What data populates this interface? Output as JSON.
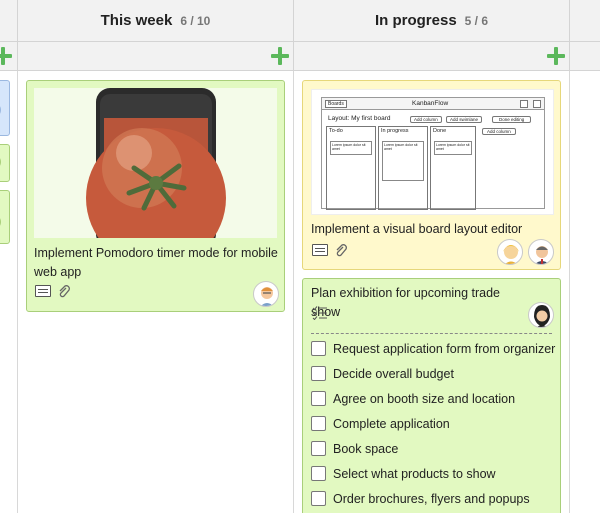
{
  "columns": [
    {
      "title": "This week",
      "count": "6 / 10"
    },
    {
      "title": "In progress",
      "count": "5 / 6"
    }
  ],
  "cards": {
    "pomodoro": {
      "text": "Implement Pomodoro timer mode for mobile web app",
      "image_desc": "phone-tomato-image",
      "color": "#e2f9c1"
    },
    "layout_editor": {
      "text": "Implement a visual board layout editor",
      "color": "#fff9cc",
      "mock": {
        "boards_btn": "Boards",
        "app_title": "KanbanFlow",
        "layout_label": "Layout: My first board",
        "add_column": "Add column",
        "add_swimlane": "Add swimlane",
        "done_editing": "Done editing",
        "col1": "To-do",
        "col2": "In progress",
        "col3": "Done",
        "add_column2": "Add column",
        "lorem": "Lorem ipsum dolor sit amet"
      }
    },
    "exhibition": {
      "text": "Plan exhibition for upcoming trade show",
      "color": "#e2f9c1",
      "checklist": [
        "Request application form from organizer",
        "Decide overall budget",
        "Agree on booth size and location",
        "Complete application",
        "Book space",
        "Select what products to show",
        "Order brochures, flyers and popups"
      ]
    }
  }
}
